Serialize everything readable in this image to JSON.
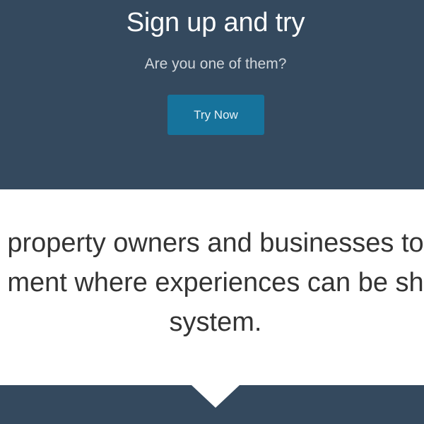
{
  "hero": {
    "title": "Sign up and try",
    "subtitle": "Are you one of them?",
    "cta_label": "Try Now"
  },
  "mission": {
    "lines": [
      "property owners and businesses to",
      "ment where experiences can be sh",
      "system."
    ]
  },
  "colors": {
    "hero_background": "#34495e",
    "button_background": "#16739c",
    "body_text": "#333333"
  }
}
